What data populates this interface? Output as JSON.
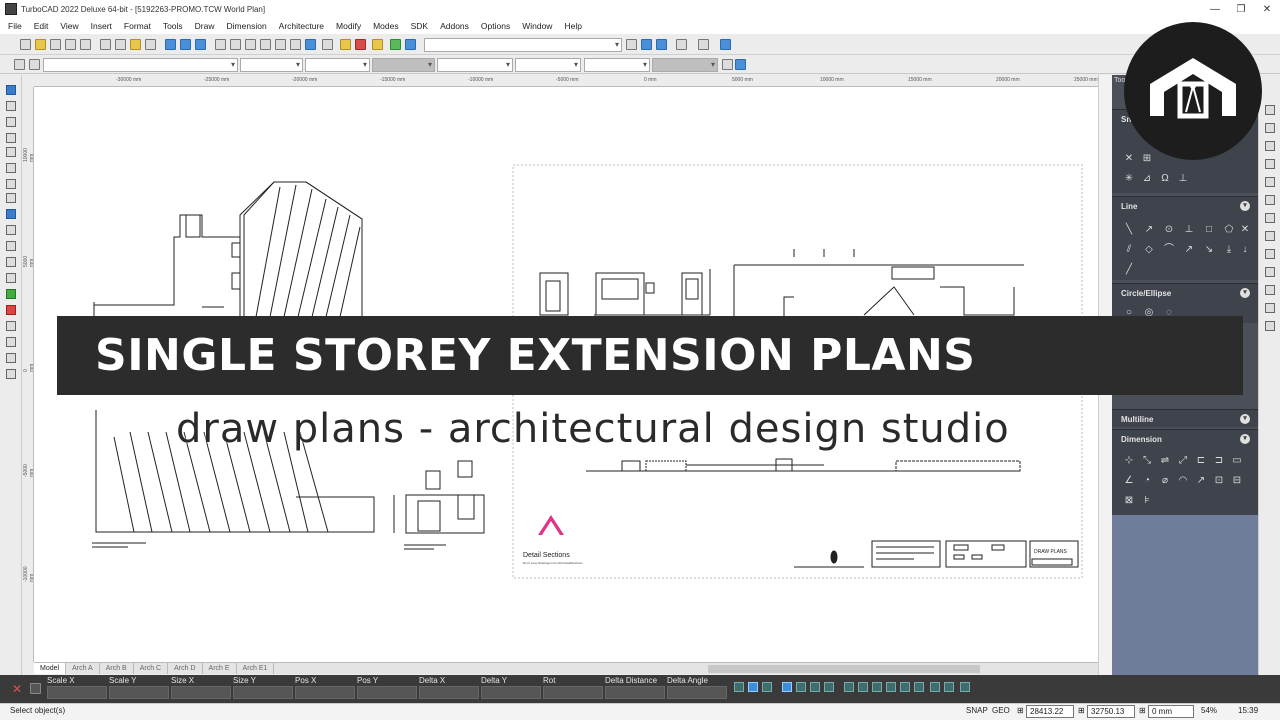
{
  "window": {
    "title": "TurboCAD 2022 Deluxe 64-bit - [5192263-PROMO.TCW World Plan]",
    "controls": [
      "minimize-icon",
      "restore-icon",
      "close-icon"
    ]
  },
  "menu": [
    "File",
    "Edit",
    "View",
    "Insert",
    "Format",
    "Tools",
    "Draw",
    "Dimension",
    "Architecture",
    "Modify",
    "Modes",
    "SDK",
    "Addons",
    "Options",
    "Window",
    "Help"
  ],
  "ruler": {
    "h_ticks": [
      "-30000 mm",
      "-25000 mm",
      "-20000 mm",
      "-15000 mm",
      "-10000 mm",
      "-5000 mm",
      "0 mm",
      "5000 mm",
      "10000 mm",
      "15000 mm",
      "20000 mm",
      "25000 mm"
    ],
    "v_ticks": [
      "10000 mm",
      "5000 mm",
      "0 mm",
      "-5000 mm",
      "-10000 mm"
    ]
  },
  "tabs": [
    "Model",
    "Arch A",
    "Arch B",
    "Arch C",
    "Arch D",
    "Arch E",
    "Arch E1"
  ],
  "coord_fields": [
    "Scale X",
    "Scale Y",
    "Size X",
    "Size Y",
    "Pos X",
    "Pos Y",
    "Delta X",
    "Delta Y",
    "Rot",
    "Delta Distance",
    "Delta Angle"
  ],
  "status": {
    "message": "Select object(s)",
    "snap": "SNAP",
    "geo": "GEO",
    "x": "28413.22 mm",
    "y": "32750.13 mm",
    "z": "0 mm",
    "zoom": "54%",
    "time": "15:39"
  },
  "palette": {
    "title": "Too",
    "sections": [
      "Line",
      "Circle/Ellipse",
      "Multiline",
      "Dimension"
    ],
    "top_label": "Sn"
  },
  "overlay": {
    "banner": "SINGLE STOREY EXTENSION PLANS",
    "subtitle": "draw plans - architectural design studio"
  },
  "drawing": {
    "detail_brand": "Detail Sections",
    "detail_tagline": "Don't Lose Drawings Info with DetailSections",
    "titleblock_brand": "DRAW PLANS"
  },
  "colors": {
    "banner_bg": "#2c2c2c",
    "palette_bg": "#4b4f58",
    "coord_bar_bg": "#3a3a3a",
    "brand_magenta": "#e0338a"
  }
}
